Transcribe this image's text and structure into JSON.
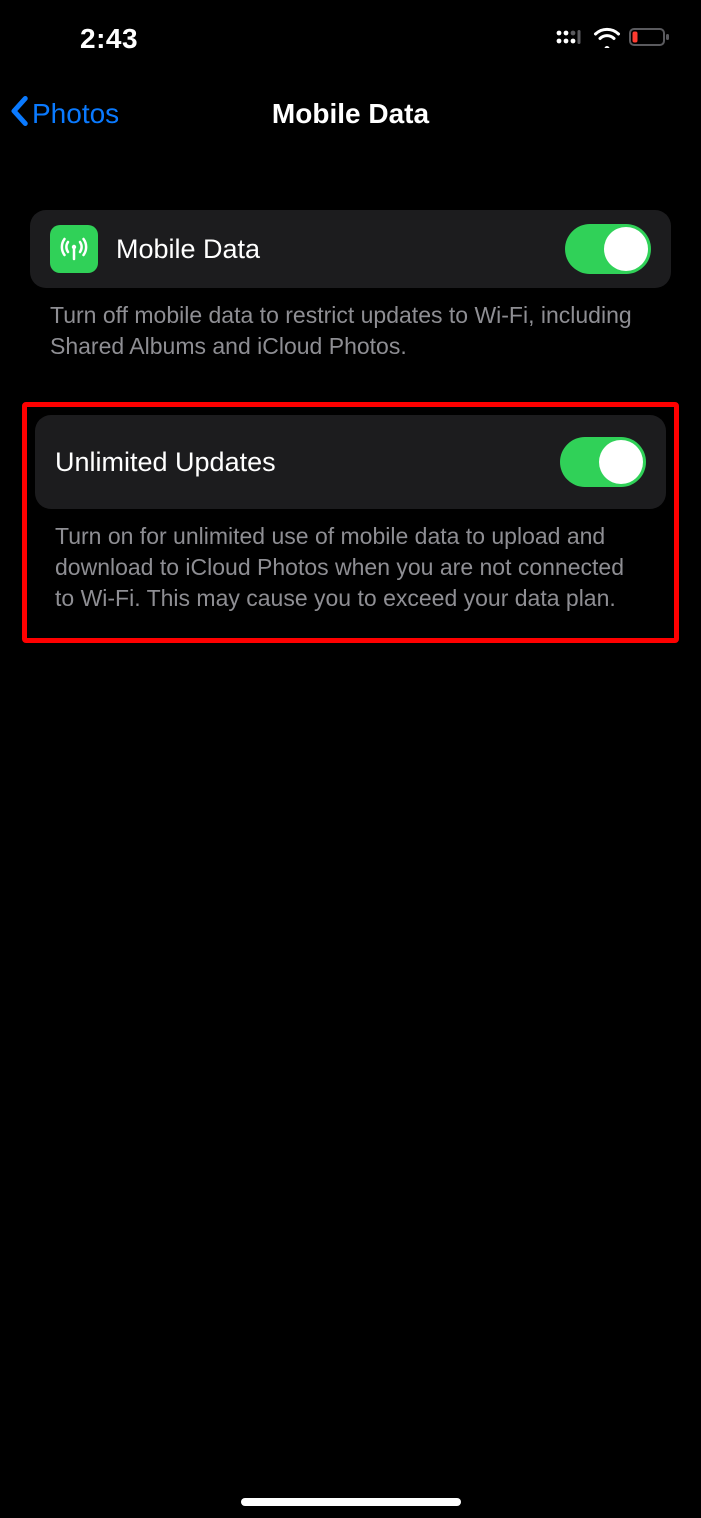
{
  "status": {
    "time": "2:43"
  },
  "nav": {
    "back_label": "Photos",
    "title": "Mobile Data"
  },
  "rows": {
    "mobile_data": {
      "label": "Mobile Data",
      "footer": "Turn off mobile data to restrict updates to Wi-Fi, including Shared Albums and iCloud Photos.",
      "toggle_on": true
    },
    "unlimited_updates": {
      "label": "Unlimited Updates",
      "footer": "Turn on for unlimited use of mobile data to upload and download to iCloud Photos when you are not connected to Wi-Fi. This may cause you to exceed your data plan.",
      "toggle_on": true
    }
  }
}
